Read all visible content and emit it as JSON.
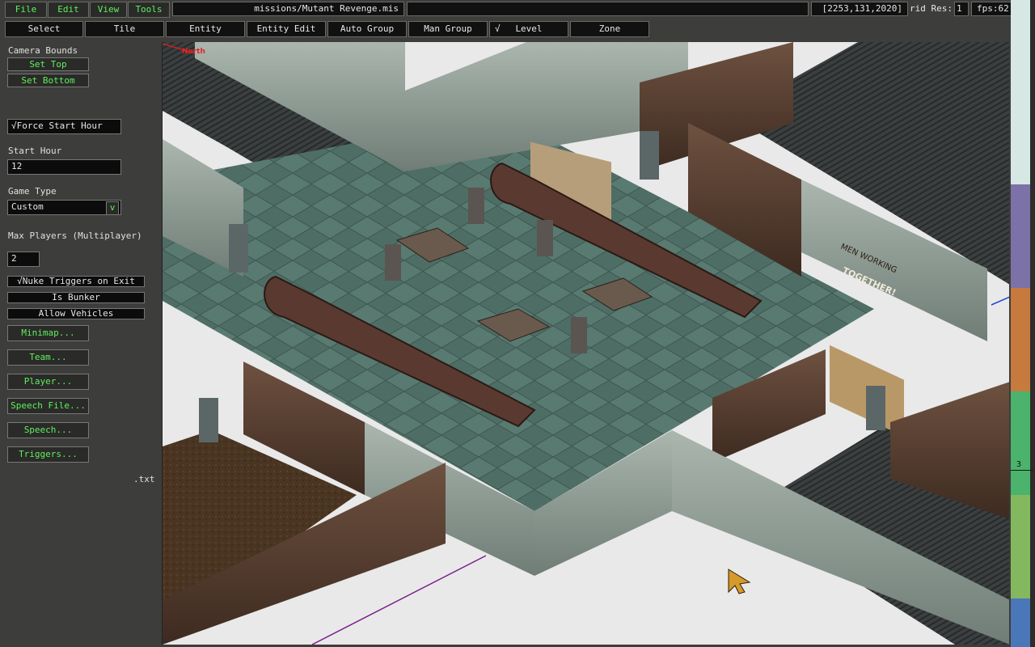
{
  "menu": {
    "file": "File",
    "edit": "Edit",
    "view": "View",
    "tools": "Tools"
  },
  "topbar": {
    "mission_path": "missions/Mutant Revenge.mis",
    "coords": "[2253,131,2020]",
    "grid_res_label": "rid Res:",
    "grid_res_value": "1",
    "fps": "fps:62"
  },
  "modes": [
    {
      "label": "Select"
    },
    {
      "label": "Tile"
    },
    {
      "label": "Entity"
    },
    {
      "label": "Entity Edit"
    },
    {
      "label": "Auto Group"
    },
    {
      "label": "Man Group"
    },
    {
      "label": "Level",
      "checked": "√"
    },
    {
      "label": "Zone"
    }
  ],
  "sidebar": {
    "camera_bounds": "Camera Bounds",
    "set_top": "Set Top",
    "set_bottom": "Set Bottom",
    "force_start_hour": "√Force Start Hour",
    "start_hour_label": "Start Hour",
    "start_hour_value": "12",
    "game_type_label": "Game Type",
    "game_type_value": "Custom",
    "game_type_arrow": "v",
    "max_players_label": "Max Players (Multiplayer)",
    "max_players_value": "2",
    "nuke_triggers": "√Nuke Triggers on Exit",
    "is_bunker": "Is Bunker",
    "allow_vehicles": "Allow Vehicles",
    "minimap": "Minimap...",
    "team": "Team...",
    "player": "Player...",
    "speech_file": "Speech File...",
    "speech": "Speech...",
    "triggers": "Triggers...",
    "txt_label": ".txt"
  },
  "viewport": {
    "north_label": "North",
    "poster_text_1": "MEN WORKING",
    "poster_text_2": "TOGETHER!"
  },
  "rightbar": {
    "level_marker": "3",
    "swatch_colors": [
      "#d6e7e4",
      "#8fa7c8",
      "#7c72a8",
      "#c77a3e",
      "#4bb36b",
      "#84b85f",
      "#4a77b7"
    ]
  },
  "colors": {
    "accent_green": "#5ef05e",
    "floor": "#4e6d65",
    "wall": "#8a9a92",
    "rust": "#5a3f30",
    "grate": "#3b3f40"
  }
}
